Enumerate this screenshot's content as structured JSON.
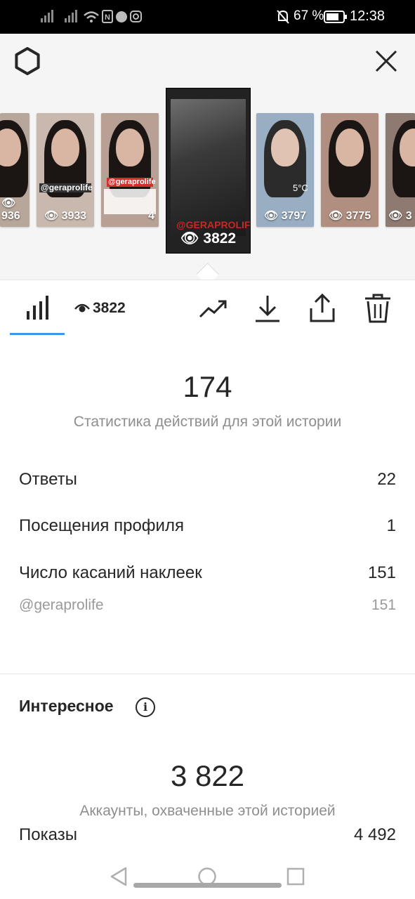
{
  "status_bar": {
    "battery_percent": "67 %",
    "time": "12:38"
  },
  "header": {
    "settings_icon": "settings-icon",
    "close_icon": "close-icon"
  },
  "stories": [
    {
      "views": "936",
      "caption": ""
    },
    {
      "views": "3933",
      "caption": "@geraprolife"
    },
    {
      "views": "4",
      "caption": "@geraprolife"
    },
    {
      "views": "3822",
      "caption": "@GERAPROLIFE",
      "selected": true
    },
    {
      "views": "3797",
      "caption": "5°C"
    },
    {
      "views": "3775",
      "caption": ""
    },
    {
      "views": "3",
      "caption": ""
    }
  ],
  "tabs": {
    "views_count": "3822",
    "icons": [
      "bar-chart-icon",
      "eye-icon",
      "trending-icon",
      "download-icon",
      "share-icon",
      "trash-icon"
    ]
  },
  "interactions": {
    "total": "174",
    "caption": "Статистика действий для этой истории",
    "rows": [
      {
        "label": "Ответы",
        "value": "22"
      },
      {
        "label": "Посещения профиля",
        "value": "1"
      },
      {
        "label": "Число касаний наклеек",
        "value": "151"
      },
      {
        "label": "@geraprolife",
        "value": "151"
      }
    ]
  },
  "discovery": {
    "title": "Интересное",
    "total": "3 822",
    "caption": "Аккаунты, охваченные этой историей",
    "rows": [
      {
        "label": "Показы",
        "value": "4 492"
      }
    ]
  },
  "colors": {
    "accent": "#3897f0",
    "text": "#262626",
    "muted": "#8e8e8e"
  }
}
